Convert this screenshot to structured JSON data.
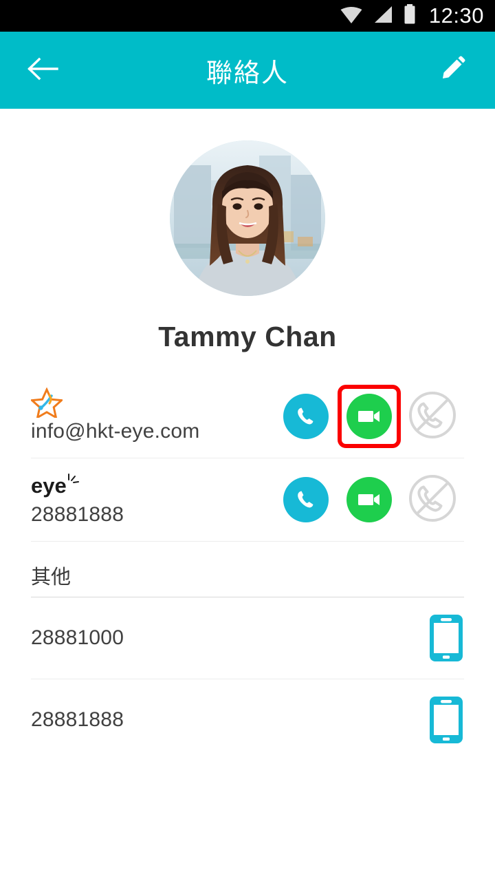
{
  "status_bar": {
    "time": "12:30",
    "icons": [
      "wifi-icon",
      "cellular-signal-icon",
      "battery-icon"
    ],
    "background": "#000000"
  },
  "app_bar": {
    "title": "聯絡人",
    "back_label": "back-arrow-icon",
    "edit_label": "pencil-edit-icon",
    "background": "#00bcc8"
  },
  "contact": {
    "name": "Tammy Chan",
    "avatar_alt": "contact-photo"
  },
  "accounts": [
    {
      "brand": "star-logo-icon",
      "brand_text": "",
      "value": "info@hkt-eye.com",
      "audio_label": "audio-call-button",
      "video_label": "video-call-button",
      "disabled_label": "call-unavailable-icon",
      "video_highlighted": true
    },
    {
      "brand": "eye-logo-icon",
      "brand_text": "eye",
      "value": "28881888",
      "audio_label": "audio-call-button",
      "video_label": "video-call-button",
      "disabled_label": "call-unavailable-icon",
      "video_highlighted": false
    }
  ],
  "other_section": {
    "title": "其他",
    "rows": [
      {
        "number": "28881000",
        "icon": "smartphone-icon"
      },
      {
        "number": "28881888",
        "icon": "smartphone-icon"
      }
    ]
  },
  "colors": {
    "accent_teal": "#00bcc8",
    "audio_cyan": "#17b9d6",
    "video_green": "#1ece4d",
    "disabled_gray": "#d4d4d4",
    "highlight_red": "#fb0000",
    "text_dark": "#414141"
  }
}
